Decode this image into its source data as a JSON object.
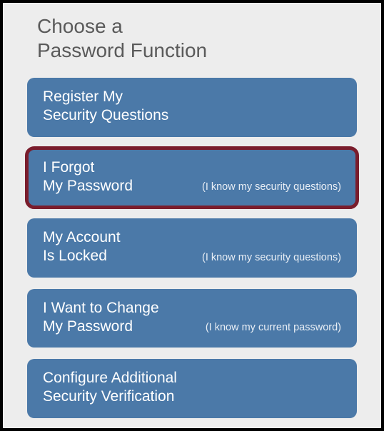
{
  "title": {
    "line1": "Choose a",
    "line2": "Password Function"
  },
  "options": [
    {
      "main_line1": "Register My",
      "main_line2": "Security Questions",
      "sub": ""
    },
    {
      "main_line1": "I Forgot",
      "main_line2": "My Password",
      "sub": "(I know my security questions)"
    },
    {
      "main_line1": "My Account",
      "main_line2": "Is Locked",
      "sub": "(I know my security questions)"
    },
    {
      "main_line1": "I Want to Change",
      "main_line2": "My Password",
      "sub": "(I know my current password)"
    },
    {
      "main_line1": "Configure Additional",
      "main_line2": "Security Verification",
      "sub": ""
    }
  ]
}
